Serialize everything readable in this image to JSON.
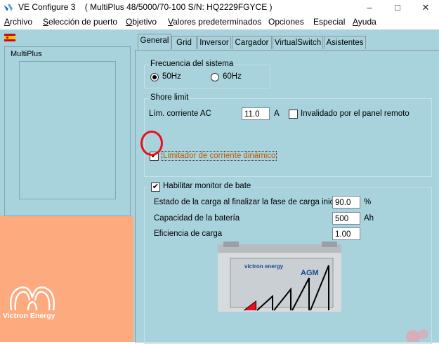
{
  "window": {
    "app_name": "VE Configure 3",
    "device_title": "( MultiPlus 48/5000/70-100 S/N: HQ2229FGYCE )",
    "controls": [
      "–",
      "□",
      "✕"
    ]
  },
  "menu": [
    {
      "hot": "A",
      "rest": "rchivo"
    },
    {
      "hot": "S",
      "rest": "elección de puerto"
    },
    {
      "hot": "O",
      "rest": "bjetivo"
    },
    {
      "hot": "V",
      "rest": "alores predeterminados"
    },
    {
      "hot": "",
      "rest": "Opciones"
    },
    {
      "hot": "",
      "rest": "Especial"
    },
    {
      "hot": "A",
      "rest": "yuda"
    }
  ],
  "sidebar": {
    "device_label": "MultiPlus",
    "logo_text": "Victron Energy"
  },
  "tabs": [
    "General",
    "Grid",
    "Inversor",
    "Cargador",
    "VirtualSwitch",
    "Asistentes"
  ],
  "general": {
    "frequency": {
      "title": "Frecuencia del sistema",
      "option_50": "50Hz",
      "option_60": "60Hz",
      "selected": "50Hz"
    },
    "shore": {
      "title": "Shore limit",
      "current_label": "Lím. corriente AC",
      "current_value": "11.0",
      "current_unit": "A",
      "override_label": "Invalidado por el panel remoto",
      "override_checked": false,
      "dynamic_label": "Limitador de corriente dinámico",
      "dynamic_checked": true
    },
    "battery_monitor": {
      "enable_label": "Habilitar monitor de bate",
      "enabled": true,
      "soc_label": "Estado de la carga al finalizar la fase de carga inicial",
      "soc_value": "90.0",
      "soc_unit": "%",
      "capacity_label": "Capacidad de la batería",
      "capacity_value": "500",
      "capacity_unit": "Ah",
      "efficiency_label": "Eficiencia de carga",
      "efficiency_value": "1.00"
    }
  },
  "battery_image": {
    "brand": "victron energy",
    "type": "AGM"
  },
  "colors": {
    "panel_bg": "#a8d2dc",
    "sidebar_bottom": "#fcaa7e",
    "annotation_red": "#e8101a",
    "dynamic_label_color": "#c05a00"
  }
}
